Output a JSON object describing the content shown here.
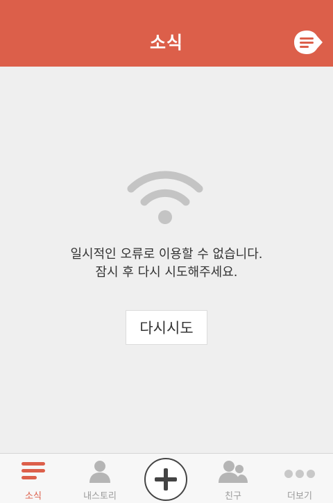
{
  "header": {
    "title": "소식",
    "compose_icon": "compose-bubble-icon",
    "background_color": "#dc5f4a"
  },
  "main": {
    "error_icon": "wifi-icon",
    "error_line1": "일시적인 오류로 이용할 수 없습니다.",
    "error_line2": "잠시 후 다시 시도해주세요.",
    "retry_label": "다시시도"
  },
  "tabbar": {
    "items": [
      {
        "label": "소식",
        "icon": "news-list-icon",
        "active": true
      },
      {
        "label": "내스토리",
        "icon": "person-icon",
        "active": false
      },
      {
        "label": "",
        "icon": "plus-icon",
        "active": false
      },
      {
        "label": "친구",
        "icon": "friends-icon",
        "active": false
      },
      {
        "label": "더보기",
        "icon": "more-dots-icon",
        "active": false
      }
    ],
    "active_color": "#dc5f4a"
  }
}
